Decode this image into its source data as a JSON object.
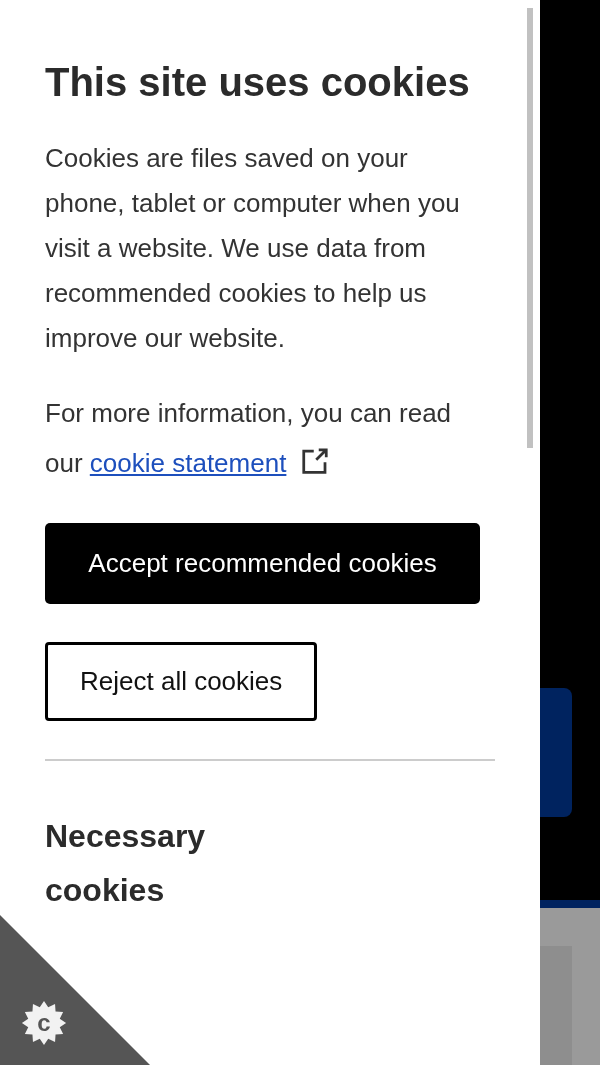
{
  "dialog": {
    "title": "This site uses cookies",
    "intro": "Cookies are files saved on your phone, tablet or computer when you visit a website. We use data from recommended cookies to help us improve our website.",
    "more_info": {
      "text": "For more information, you can read our",
      "link": "cookie statement"
    },
    "buttons": [
      {
        "label": "Accept recommended cookies",
        "kind": "primary"
      },
      {
        "label": "Reject all cookies",
        "kind": "secondary"
      }
    ],
    "section_heading": "Necessary cookies"
  },
  "corner_badge": {
    "label": "c"
  }
}
